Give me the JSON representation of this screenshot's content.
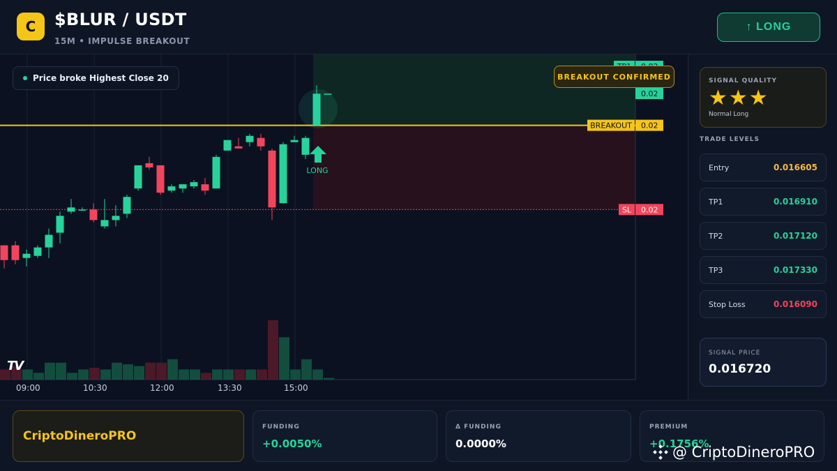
{
  "header": {
    "logo_letter": "C",
    "pair": "$BLUR / USDT",
    "subtitle": "15M • IMPULSE BREAKOUT",
    "long_button": "↑ LONG"
  },
  "chart": {
    "legend_text": "Price broke Highest Close 20",
    "banner": "BREAKOUT CONFIRMED",
    "signal_arrow_label": "LONG",
    "tv_logo": "TV",
    "time_labels": [
      "09:00",
      "10:30",
      "12:00",
      "13:30",
      "15:00"
    ],
    "price_tags": [
      {
        "label": "TP1",
        "value": "0.02"
      },
      {
        "label": "",
        "value": "0.02"
      },
      {
        "label": "BREAKOUT",
        "value": "0.02"
      },
      {
        "label": "SL",
        "value": "0.02"
      }
    ],
    "colors": {
      "up": "#27d39a",
      "down": "#f2455d",
      "breakout": "#f5c518",
      "sl": "#f2455d"
    }
  },
  "chart_data": {
    "type": "candlestick",
    "candles": [
      {
        "o": 0.01652,
        "h": 0.01652,
        "l": 0.01641,
        "c": 0.01645
      },
      {
        "o": 0.01652,
        "h": 0.01654,
        "l": 0.01643,
        "c": 0.01645
      },
      {
        "o": 0.01646,
        "h": 0.0165,
        "l": 0.01642,
        "c": 0.01648
      },
      {
        "o": 0.01647,
        "h": 0.01652,
        "l": 0.01646,
        "c": 0.01651
      },
      {
        "o": 0.01651,
        "h": 0.0166,
        "l": 0.01646,
        "c": 0.01657
      },
      {
        "o": 0.01658,
        "h": 0.01668,
        "l": 0.01653,
        "c": 0.01666
      },
      {
        "o": 0.01668,
        "h": 0.01674,
        "l": 0.01667,
        "c": 0.0167
      },
      {
        "o": 0.01669,
        "h": 0.0167,
        "l": 0.01669,
        "c": 0.01669
      },
      {
        "o": 0.01669,
        "h": 0.01672,
        "l": 0.01663,
        "c": 0.01664
      },
      {
        "o": 0.01661,
        "h": 0.01674,
        "l": 0.0166,
        "c": 0.01664
      },
      {
        "o": 0.01664,
        "h": 0.01671,
        "l": 0.01661,
        "c": 0.01666
      },
      {
        "o": 0.01667,
        "h": 0.01676,
        "l": 0.01665,
        "c": 0.01675
      },
      {
        "o": 0.01679,
        "h": 0.0169,
        "l": 0.01678,
        "c": 0.0169
      },
      {
        "o": 0.01691,
        "h": 0.01694,
        "l": 0.01688,
        "c": 0.01689
      },
      {
        "o": 0.0169,
        "h": 0.0169,
        "l": 0.01676,
        "c": 0.01677
      },
      {
        "o": 0.01678,
        "h": 0.01681,
        "l": 0.01677,
        "c": 0.0168
      },
      {
        "o": 0.01679,
        "h": 0.01681,
        "l": 0.01677,
        "c": 0.01681
      },
      {
        "o": 0.0168,
        "h": 0.01683,
        "l": 0.01679,
        "c": 0.01682
      },
      {
        "o": 0.01681,
        "h": 0.01684,
        "l": 0.01676,
        "c": 0.01678
      },
      {
        "o": 0.01679,
        "h": 0.01695,
        "l": 0.01679,
        "c": 0.01694
      },
      {
        "o": 0.01697,
        "h": 0.01702,
        "l": 0.01697,
        "c": 0.01702
      },
      {
        "o": 0.01699,
        "h": 0.01703,
        "l": 0.01698,
        "c": 0.01698
      },
      {
        "o": 0.01701,
        "h": 0.01705,
        "l": 0.01699,
        "c": 0.01704
      },
      {
        "o": 0.01703,
        "h": 0.01705,
        "l": 0.01697,
        "c": 0.01699
      },
      {
        "o": 0.01697,
        "h": 0.01698,
        "l": 0.01664,
        "c": 0.0167
      },
      {
        "o": 0.01672,
        "h": 0.01701,
        "l": 0.01672,
        "c": 0.017
      },
      {
        "o": 0.01701,
        "h": 0.01704,
        "l": 0.01701,
        "c": 0.01702
      },
      {
        "o": 0.01695,
        "h": 0.01704,
        "l": 0.01693,
        "c": 0.01703
      },
      {
        "o": 0.01709,
        "h": 0.01728,
        "l": 0.01709,
        "c": 0.01724
      },
      {
        "o": 0.01724,
        "h": 0.01724,
        "l": 0.01724,
        "c": 0.01724
      }
    ],
    "volumes": [
      6,
      8,
      6,
      4,
      10,
      10,
      4,
      6,
      7,
      6,
      10,
      9,
      8,
      10,
      10,
      12,
      6,
      6,
      4,
      6,
      6,
      6,
      6,
      6,
      35,
      25,
      6,
      12,
      6,
      1
    ],
    "breakout_level": 0.01709,
    "sl_level": 0.01669,
    "tp1_level": 0.01737,
    "ylim": [
      0.0163,
      0.0174
    ]
  },
  "signal_quality": {
    "title": "SIGNAL QUALITY",
    "stars": "★★★",
    "star_count": 3,
    "star_max": 3,
    "subtitle": "Normal Long"
  },
  "trade_levels": {
    "title": "TRADE LEVELS",
    "items": [
      {
        "label": "Entry",
        "value": "0.016605",
        "color": "#f5b942"
      },
      {
        "label": "TP1",
        "value": "0.016910",
        "color": "#27d39a"
      },
      {
        "label": "TP2",
        "value": "0.017120",
        "color": "#27d39a"
      },
      {
        "label": "TP3",
        "value": "0.017330",
        "color": "#27d39a"
      },
      {
        "label": "Stop Loss",
        "value": "0.016090",
        "color": "#f2455d"
      }
    ]
  },
  "signal_price": {
    "title": "SIGNAL PRICE",
    "value": "0.016720"
  },
  "footer": {
    "brand": "CriptoDineroPRO",
    "cards": [
      {
        "title": "FUNDING",
        "value": "+0.0050%",
        "color": "#27d39a"
      },
      {
        "title": "Δ FUNDING",
        "value": "0.0000%",
        "color": "#ffffff"
      },
      {
        "title": "PREMIUM",
        "value": "+0.1756%",
        "color": "#27d39a"
      }
    ],
    "watermark": "@ CriptoDineroPRO"
  }
}
